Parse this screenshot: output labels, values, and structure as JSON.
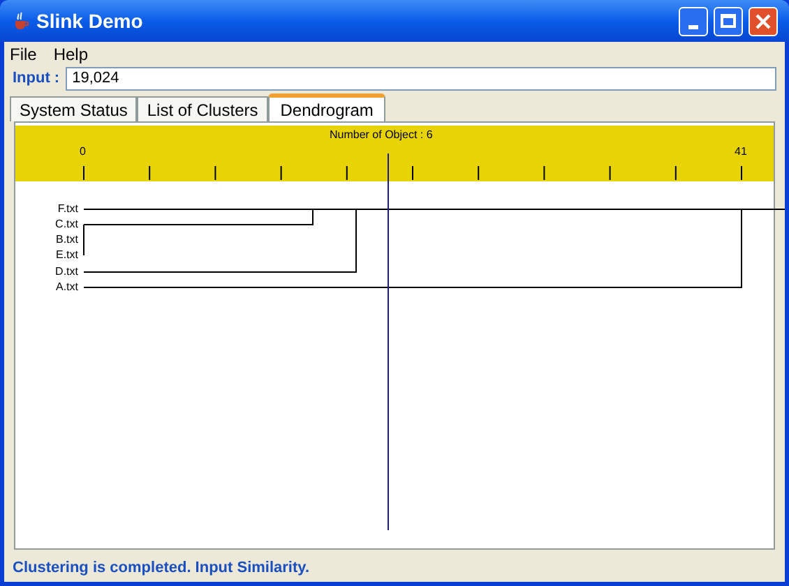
{
  "window": {
    "title": "Slink Demo"
  },
  "menu": [
    "File",
    "Help"
  ],
  "input": {
    "label": "Input :",
    "value": "19,024"
  },
  "tabs": [
    {
      "label": "System Status",
      "selected": false
    },
    {
      "label": "List of Clusters",
      "selected": false
    },
    {
      "label": "Dendrogram",
      "selected": true
    }
  ],
  "dendrogram": {
    "title": "Number of Object : 6",
    "scale_start": "0",
    "scale_end": "41",
    "leaves": [
      "F.txt",
      "C.txt",
      "B.txt",
      "E.txt",
      "D.txt",
      "A.txt"
    ]
  },
  "status_bar": "Clustering is completed. Input Similarity."
}
